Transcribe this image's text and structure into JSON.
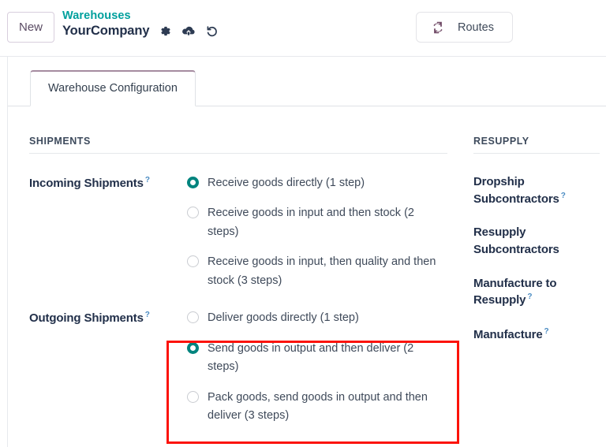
{
  "header": {
    "new_label": "New",
    "breadcrumb_parent": "Warehouses",
    "breadcrumb_current": "YourCompany",
    "icons": [
      "gear-icon",
      "cloud-upload-icon",
      "undo-icon"
    ],
    "routes_label": "Routes",
    "routes_icon": "exchange-refresh-icon"
  },
  "tabs": [
    {
      "label": "Warehouse Configuration",
      "active": true
    }
  ],
  "shipments": {
    "group_title": "SHIPMENTS",
    "incoming": {
      "label": "Incoming Shipments",
      "help": "?",
      "options": [
        {
          "label": "Receive goods directly (1 step)",
          "checked": true
        },
        {
          "label": "Receive goods in input and then stock (2 steps)",
          "checked": false
        },
        {
          "label": "Receive goods in input, then quality and then stock (3 steps)",
          "checked": false
        }
      ]
    },
    "outgoing": {
      "label": "Outgoing Shipments",
      "help": "?",
      "options": [
        {
          "label": "Deliver goods directly (1 step)",
          "checked": false
        },
        {
          "label": "Send goods in output and then deliver (2 steps)",
          "checked": true
        },
        {
          "label": "Pack goods, send goods in output and then deliver (3 steps)",
          "checked": false
        }
      ]
    }
  },
  "resupply": {
    "group_title": "RESUPPLY",
    "items": [
      {
        "label": "Dropship Subcontractors",
        "help": "?"
      },
      {
        "label": "Resupply Subcontractors",
        "help": ""
      },
      {
        "label": "Manufacture to Resupply",
        "help": "?"
      },
      {
        "label": "Manufacture",
        "help": "?"
      }
    ]
  },
  "annotation": {
    "highlight_color": "#fc1309"
  },
  "colors": {
    "accent_teal": "#00847e",
    "breadcrumb_teal": "#00a09d",
    "brand_purple": "#714b67",
    "text_dark": "#22304a",
    "text_body": "#3f4a5a",
    "help_blue": "#4a8bc2"
  }
}
